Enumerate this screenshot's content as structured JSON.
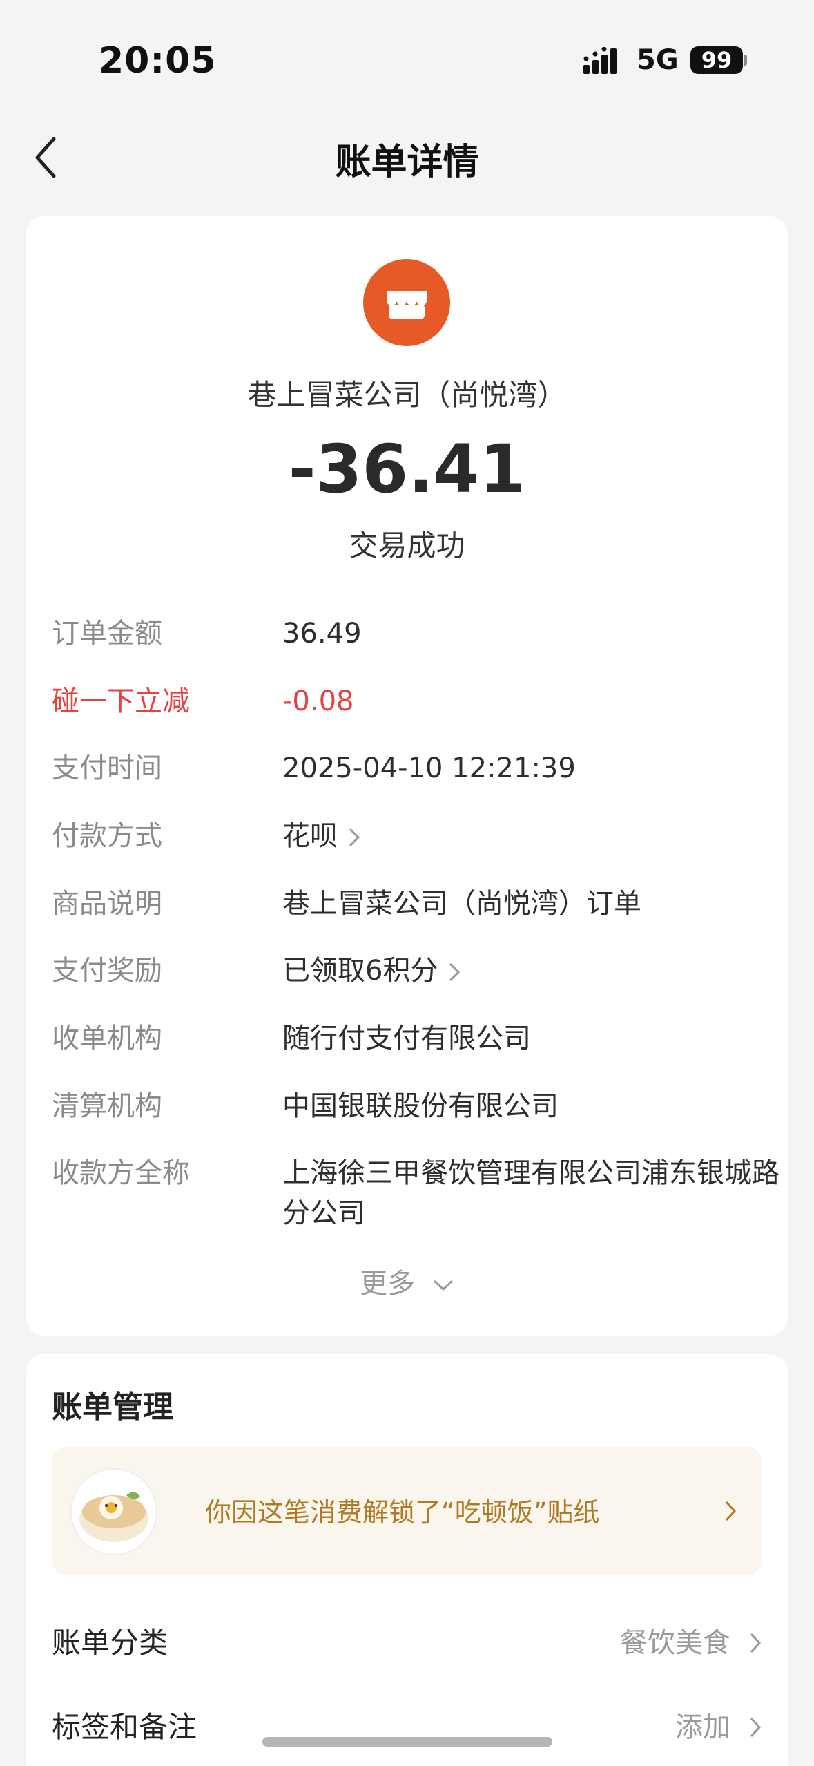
{
  "status_bar": {
    "time": "20:05",
    "network": "5G",
    "battery": "99"
  },
  "nav": {
    "title": "账单详情"
  },
  "merchant": {
    "name": "巷上冒菜公司（尚悦湾）",
    "icon_color": "#e85a25"
  },
  "amount": "-36.41",
  "status_text": "交易成功",
  "details": [
    {
      "label": "订单金额",
      "value": "36.49",
      "has_chevron": false,
      "highlight": false
    },
    {
      "label": "碰一下立减",
      "value": "-0.08",
      "has_chevron": false,
      "highlight": true
    },
    {
      "label": "支付时间",
      "value": "2025-04-10 12:21:39",
      "has_chevron": false,
      "highlight": false
    },
    {
      "label": "付款方式",
      "value": "花呗",
      "has_chevron": true,
      "highlight": false
    },
    {
      "label": "商品说明",
      "value": "巷上冒菜公司（尚悦湾）订单",
      "has_chevron": false,
      "highlight": false
    },
    {
      "label": "支付奖励",
      "value": "已领取6积分",
      "has_chevron": true,
      "highlight": false
    },
    {
      "label": "收单机构",
      "value": "随行付支付有限公司",
      "has_chevron": false,
      "highlight": false
    },
    {
      "label": "清算机构",
      "value": "中国银联股份有限公司",
      "has_chevron": false,
      "highlight": false
    },
    {
      "label": "收款方全称",
      "value": "上海徐三甲餐饮管理有限公司浦东银城路分公司",
      "has_chevron": false,
      "highlight": false
    }
  ],
  "more_label": "更多",
  "manage": {
    "title": "账单管理",
    "sticker_text": "你因这笔消费解锁了“吃顿饭”贴纸",
    "rows": [
      {
        "label": "账单分类",
        "value": "餐饮美食"
      },
      {
        "label": "标签和备注",
        "value": "添加"
      }
    ]
  },
  "colors": {
    "accent_red": "#e8423f",
    "sticker_text": "#b07a22"
  }
}
